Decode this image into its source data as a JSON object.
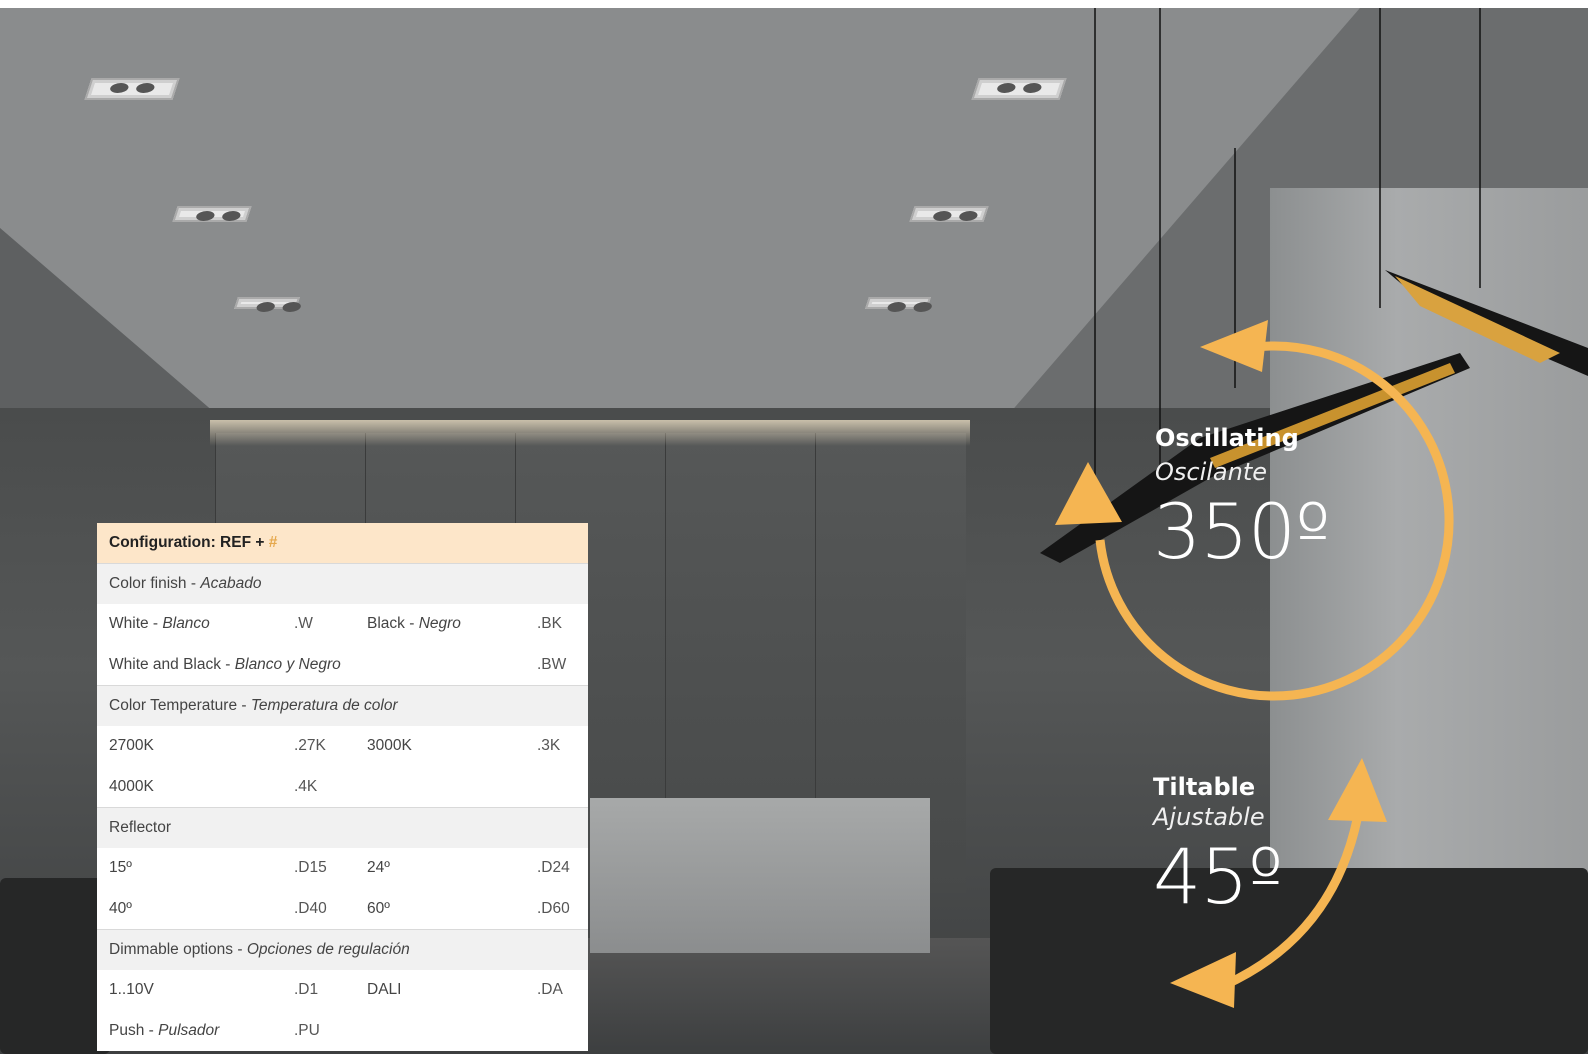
{
  "config": {
    "header_label": "Configuration: REF + ",
    "header_hash": "#",
    "sections": {
      "finish": {
        "title": "Color finish - ",
        "title_es": "Acabado",
        "rows": [
          {
            "a_en": "White - ",
            "a_es": "Blanco",
            "a_code": ".W",
            "b_en": "Black - ",
            "b_es": "Negro",
            "b_code": ".BK"
          },
          {
            "a_en": "White and Black - ",
            "a_es": "Blanco y Negro",
            "b_code": ".BW"
          }
        ]
      },
      "temperature": {
        "title": "Color Temperature - ",
        "title_es": "Temperatura de color",
        "rows": [
          {
            "a": "2700K",
            "a_code": ".27K",
            "b": "3000K",
            "b_code": ".3K"
          },
          {
            "a": "4000K",
            "a_code": ".4K"
          }
        ]
      },
      "reflector": {
        "title": "Reflector",
        "rows": [
          {
            "a": "15º",
            "a_code": ".D15",
            "b": "24º",
            "b_code": ".D24"
          },
          {
            "a": "40º",
            "a_code": ".D40",
            "b": "60º",
            "b_code": ".D60"
          }
        ]
      },
      "dimmable": {
        "title": "Dimmable options - ",
        "title_es": "Opciones de regulación",
        "rows": [
          {
            "a": "1..10V",
            "a_code": ".D1",
            "b": "DALI",
            "b_code": ".DA"
          },
          {
            "a_en": "Push - ",
            "a_es": "Pulsador",
            "a_code": ".PU"
          }
        ]
      }
    }
  },
  "oscillating": {
    "title": "Oscillating",
    "subtitle": "Oscilante",
    "value": "350º"
  },
  "tiltable": {
    "title": "Tiltable",
    "subtitle": "Ajustable",
    "value": "45º"
  },
  "colors": {
    "accent": "#f5b552",
    "header_bg": "#fde6c9",
    "section_bg": "#f1f1f1"
  }
}
